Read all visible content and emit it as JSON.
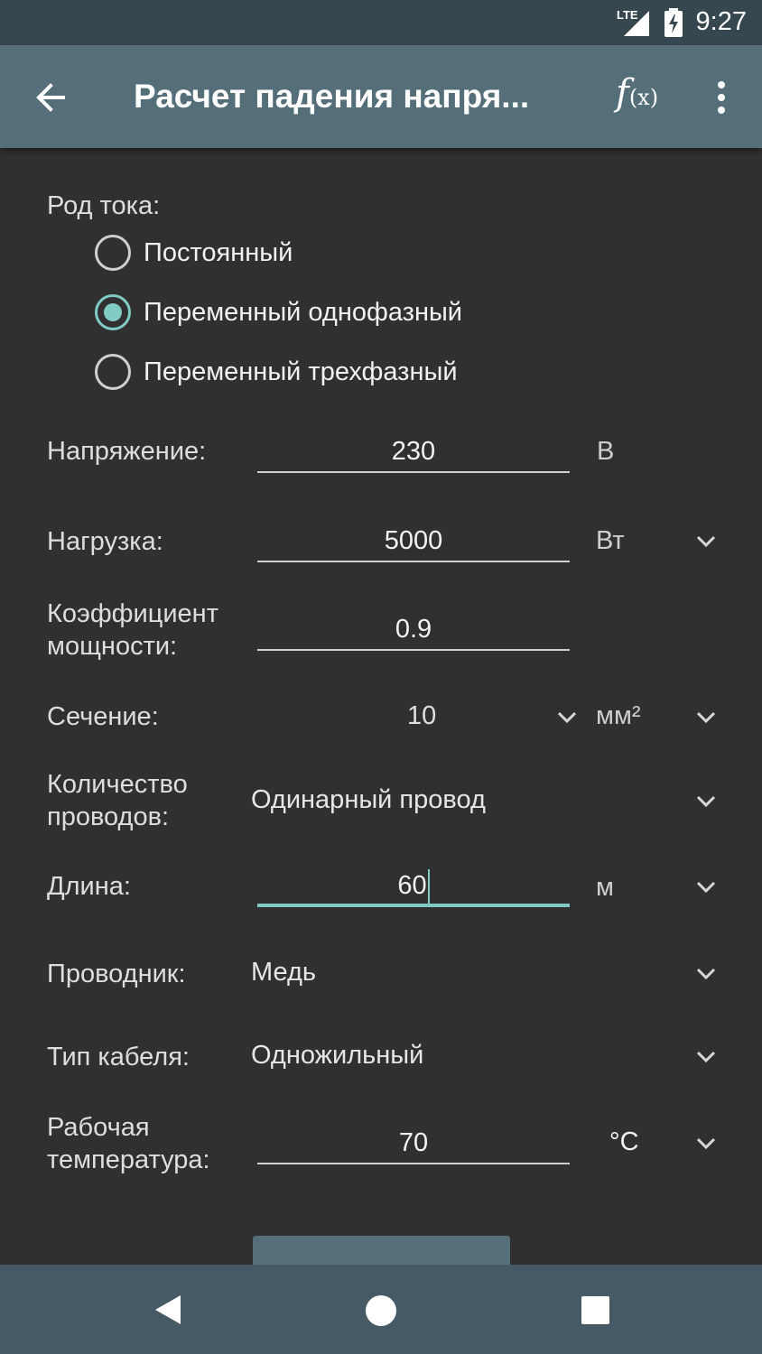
{
  "status_bar": {
    "time": "9:27",
    "network": "LTE"
  },
  "app_bar": {
    "title": "Расчет падения напря...",
    "fx_label": "f",
    "fx_arg": "(x)"
  },
  "form": {
    "current_type": {
      "label": "Род тока:",
      "options": [
        "Постоянный",
        "Переменный однофазный",
        "Переменный трехфазный"
      ],
      "selected": "Переменный однофазный"
    },
    "voltage": {
      "label": "Напряжение:",
      "value": "230",
      "unit": "В"
    },
    "load": {
      "label": "Нагрузка:",
      "value": "5000",
      "unit": "Вт"
    },
    "power_factor": {
      "label_line1": "Коэффициент",
      "label_line2": "мощности:",
      "value": "0.9"
    },
    "cross_section": {
      "label": "Сечение:",
      "value": "10",
      "unit": "мм²"
    },
    "wire_count": {
      "label_line1": "Количество",
      "label_line2": "проводов:",
      "value": "Одинарный провод"
    },
    "length": {
      "label": "Длина:",
      "value": "60",
      "unit": "м"
    },
    "conductor": {
      "label": "Проводник:",
      "value": "Медь"
    },
    "cable_type": {
      "label": "Тип кабеля:",
      "value": "Одножильный"
    },
    "temperature": {
      "label_line1": "Рабочая",
      "label_line2": "температура:",
      "value": "70",
      "unit": "°C"
    }
  },
  "colors": {
    "accent": "#80cbc4",
    "app_bar": "#546e7a",
    "status_bar": "#37474f",
    "background": "#303030",
    "nav_bar": "#455a64"
  },
  "icons": [
    "lte-signal-icon",
    "battery-charging-icon",
    "back-arrow-icon",
    "function-icon",
    "more-vert-icon",
    "chevron-down-icon",
    "nav-back-icon",
    "nav-home-icon",
    "nav-recents-icon"
  ]
}
